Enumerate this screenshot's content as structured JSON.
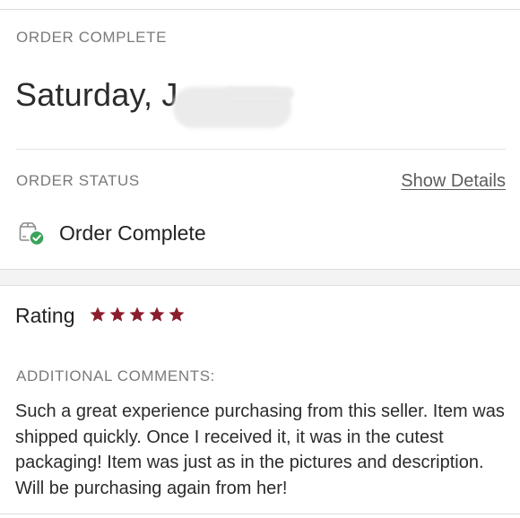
{
  "order": {
    "complete_heading": "ORDER COMPLETE",
    "date_text": "Saturday, J"
  },
  "status": {
    "heading": "ORDER STATUS",
    "show_details_label": "Show Details",
    "status_text": "Order Complete",
    "status_icon": "package-check-icon",
    "check_color": "#3aa35a"
  },
  "rating": {
    "label": "Rating",
    "stars": 5,
    "max_stars": 5,
    "star_color": "#8b1e2d",
    "star_icon": "star-icon"
  },
  "comments": {
    "heading": "ADDITIONAL COMMENTS:",
    "text": "Such a great experience purchasing from this seller. Item was shipped quickly. Once I received it, it was in the cutest packaging! Item was just as in the pictures and description. Will be purchasing again from her!"
  }
}
